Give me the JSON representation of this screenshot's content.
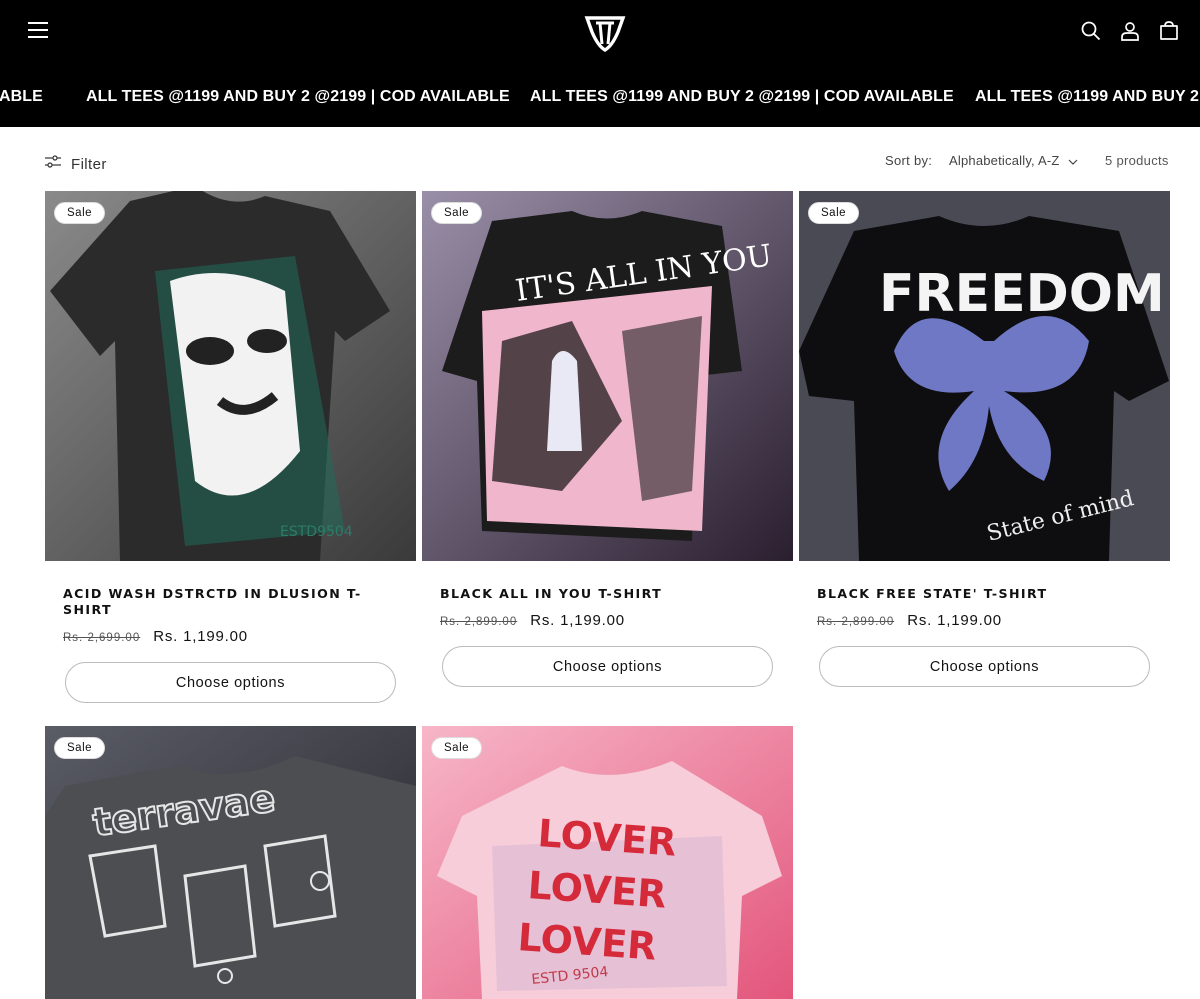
{
  "announcement": {
    "items": [
      "ABLE",
      "ALL TEES @1199 AND BUY 2 @2199 | COD AVAILABLE",
      "ALL TEES @1199 AND BUY 2 @2199 | COD AVAILABLE",
      "ALL TEES @1199 AND BUY 2 @2"
    ]
  },
  "header": {
    "icons": [
      "menu-icon",
      "brand-logo",
      "search-icon",
      "account-icon",
      "cart-icon"
    ]
  },
  "toolbar": {
    "filter_label": "Filter",
    "sort_label": "Sort by:",
    "sort_value": "Alphabetically, A-Z",
    "product_count": "5 products"
  },
  "products": [
    {
      "badge": "Sale",
      "title": "ACID WASH DSTRCTD IN DLUSION T-SHIRT",
      "price_old": "Rs. 2,699.00",
      "price_new": "Rs. 1,199.00",
      "cta": "Choose options"
    },
    {
      "badge": "Sale",
      "title": "BLACK ALL IN YOU T-SHIRT",
      "price_old": "Rs. 2,899.00",
      "price_new": "Rs. 1,199.00",
      "cta": "Choose options"
    },
    {
      "badge": "Sale",
      "title": "BLACK FREE STATE' T-SHIRT",
      "price_old": "Rs. 2,899.00",
      "price_new": "Rs. 1,199.00",
      "cta": "Choose options"
    },
    {
      "badge": "Sale"
    },
    {
      "badge": "Sale"
    }
  ],
  "colors": {
    "header_bg": "#000000",
    "page_bg": "#ffffff",
    "text": "#121212"
  }
}
